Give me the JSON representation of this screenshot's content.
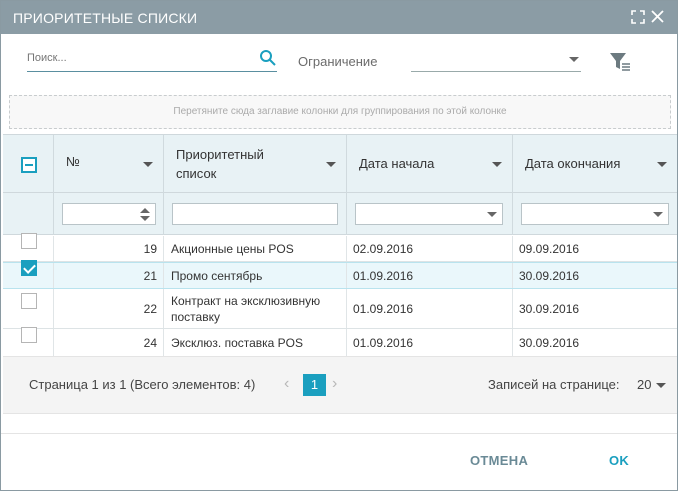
{
  "dialog": {
    "title": "ПРИОРИТЕТНЫЕ СПИСКИ"
  },
  "toolbar": {
    "search_placeholder": "Поиск...",
    "restriction_label": "Ограничение",
    "restriction_value": ""
  },
  "group_panel": {
    "hint": "Перетяните сюда заглавие колонки для группирования по этой колонке"
  },
  "grid": {
    "columns": {
      "number": "№",
      "priority_list": "Приоритетный список",
      "start_date": "Дата начала",
      "end_date": "Дата окончания"
    },
    "rows": [
      {
        "selected": false,
        "number": "19",
        "name": "Акционные цены POS",
        "start": "02.09.2016",
        "end": "09.09.2016"
      },
      {
        "selected": true,
        "number": "21",
        "name": "Промо сентябрь",
        "start": "01.09.2016",
        "end": "30.09.2016"
      },
      {
        "selected": false,
        "number": "22",
        "name": "Контракт на эксклюзивную поставку",
        "start": "01.09.2016",
        "end": "30.09.2016"
      },
      {
        "selected": false,
        "number": "24",
        "name": "Эксклюз. поставка POS",
        "start": "01.09.2016",
        "end": "30.09.2016"
      }
    ]
  },
  "pager": {
    "info": "Страница 1 из 1 (Всего элементов: 4)",
    "current_page": "1",
    "prev_symbol": "‹",
    "next_symbol": "›",
    "records_label": "Записей на странице:",
    "records_value": "20"
  },
  "footer": {
    "cancel_label": "ОТМЕНА",
    "ok_label": "OK"
  },
  "colors": {
    "titlebar": "#8b9ca5",
    "accent": "#1a9fbf",
    "header_bg": "#e8f2f5"
  }
}
